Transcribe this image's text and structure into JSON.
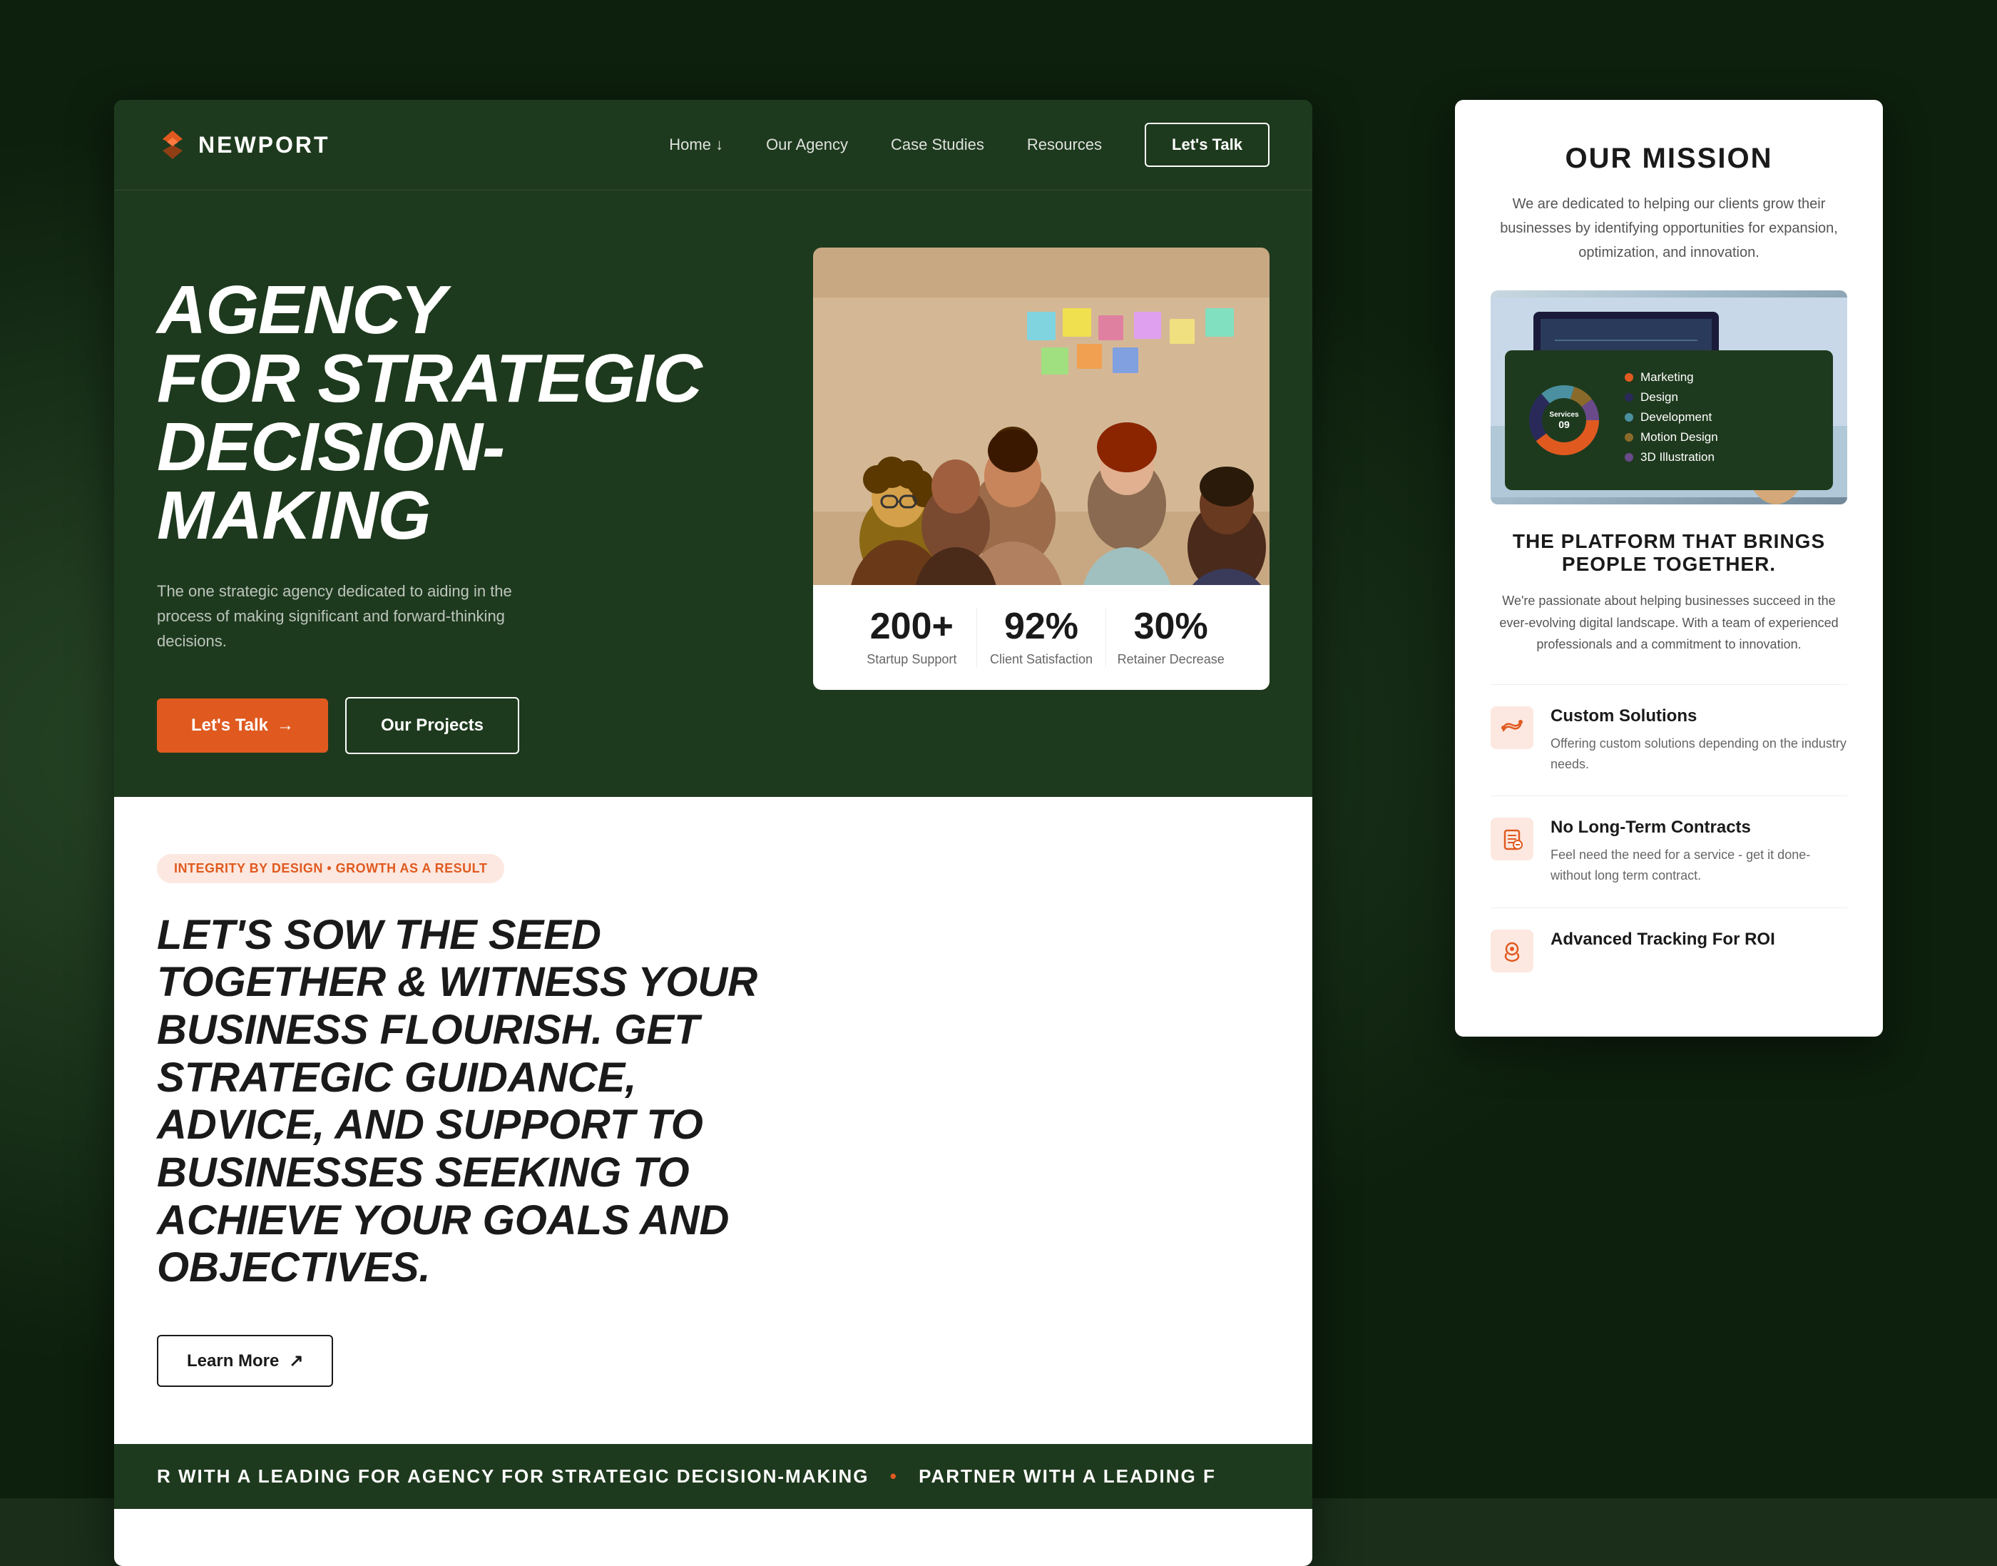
{
  "background": {
    "color": "#1a2e1a"
  },
  "navbar": {
    "logo_text": "NEWPORT",
    "nav_items": [
      {
        "label": "Home ↓",
        "id": "home"
      },
      {
        "label": "Our Agency",
        "id": "our-agency"
      },
      {
        "label": "Case Studies",
        "id": "case-studies"
      },
      {
        "label": "Resources",
        "id": "resources"
      }
    ],
    "cta_label": "Let's Talk"
  },
  "hero": {
    "title_line1": "AGENCY",
    "title_line2": "FOR STRATEGIC",
    "title_line3": "DECISION-MAKING",
    "subtitle": "The one strategic agency dedicated to aiding in the process of making significant and forward-thinking decisions.",
    "btn_primary": "Let's Talk",
    "btn_secondary": "Our Projects",
    "stats": [
      {
        "number": "200+",
        "label": "Startup Support"
      },
      {
        "number": "92%",
        "label": "Client Satisfaction"
      },
      {
        "number": "30%",
        "label": "Retainer Decrease"
      }
    ]
  },
  "white_section": {
    "badge": "INTEGRITY BY DESIGN • GROWTH AS A RESULT",
    "heading": "LET'S SOW THE SEED TOGETHER & WITNESS YOUR BUSINESS FLOURISH. GET STRATEGIC GUIDANCE, ADVICE, AND SUPPORT TO BUSINESSES SEEKING TO ACHIEVE YOUR GOALS AND OBJECTIVES.",
    "learn_more": "Learn More"
  },
  "ticker": {
    "text1": "R WITH A LEADING FOR AGENCY FOR STRATEGIC DECISION-MAKING",
    "dot": "•",
    "text2": "PARTNER WITH A LEADING F"
  },
  "mission_panel": {
    "title": "OUR MISSION",
    "description": "We are dedicated to helping our clients grow their businesses by identifying opportunities for expansion, optimization, and innovation.",
    "chart": {
      "center_text": "Services",
      "center_number": "09",
      "legend": [
        {
          "label": "Marketing",
          "color": "#e05a20"
        },
        {
          "label": "Design",
          "color": "#2a2a4a"
        },
        {
          "label": "Development",
          "color": "#4a90a0"
        },
        {
          "label": "Motion Design",
          "color": "#8a6a2a"
        },
        {
          "label": "3D Illustration",
          "color": "#6a4a8a"
        }
      ]
    },
    "platform_title": "THE PLATFORM THAT BRINGS PEOPLE TOGETHER.",
    "platform_text": "We're passionate about helping businesses succeed in the ever-evolving digital landscape. With a team of experienced professionals and a commitment to innovation.",
    "features": [
      {
        "id": "custom-solutions",
        "icon": "⇌",
        "title": "Custom Solutions",
        "desc": "Offering custom solutions depending on the industry needs."
      },
      {
        "id": "no-contracts",
        "icon": "📋",
        "title": "No Long-Term Contracts",
        "desc": "Feel need the need for a service - get it done-without long term contract."
      },
      {
        "id": "advanced-tracking",
        "icon": "📍",
        "title": "Advanced Tracking For ROI",
        "desc": ""
      }
    ]
  }
}
